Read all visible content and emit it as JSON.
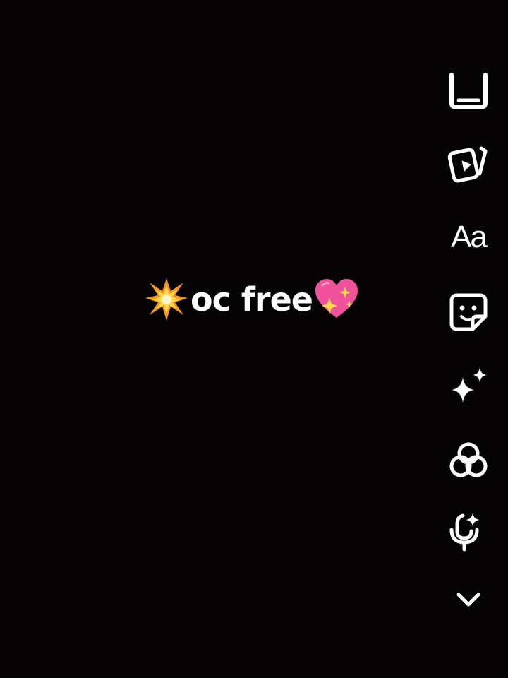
{
  "caption": {
    "lead_emoji": "collision-emoji",
    "text": "oc free",
    "trail_emoji": "sparkling-heart-emoji"
  },
  "toolbar": {
    "items": [
      {
        "name": "crop-icon"
      },
      {
        "name": "clips-icon"
      },
      {
        "name": "text-tool",
        "label": "Aa"
      },
      {
        "name": "sticker-icon"
      },
      {
        "name": "effects-sparkle-icon"
      },
      {
        "name": "filters-icon"
      },
      {
        "name": "voice-effects-icon"
      },
      {
        "name": "more-chevron-icon"
      }
    ]
  },
  "colors": {
    "background": "#050304",
    "icon": "#ffffff",
    "heart_pink": "#f0529b",
    "burst_orange": "#f7931e",
    "burst_yellow": "#ffd84a"
  }
}
